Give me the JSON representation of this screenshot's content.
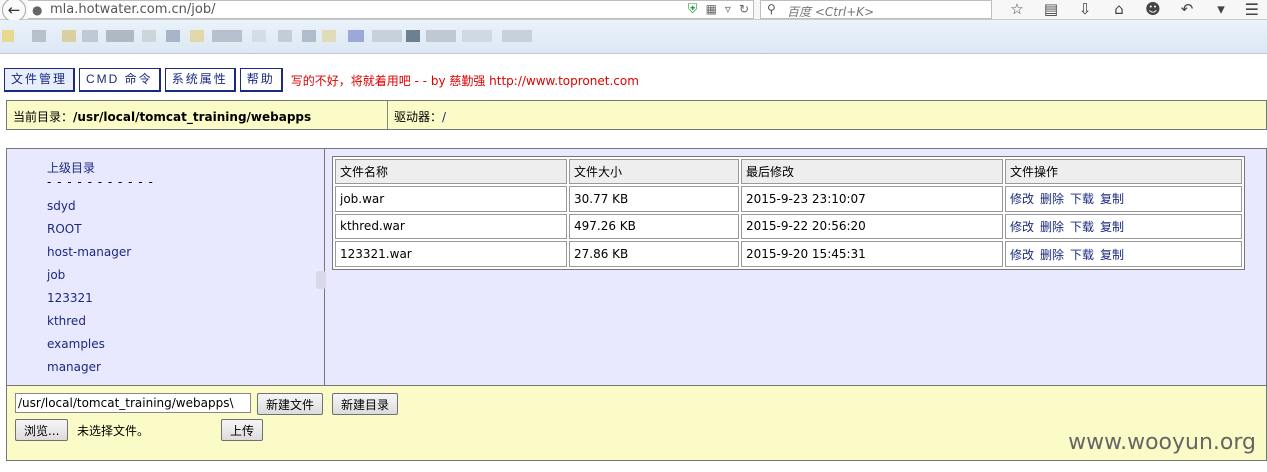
{
  "browser": {
    "url": "mla.hotwater.com.cn/job/",
    "search_placeholder": "百度 <Ctrl+K>"
  },
  "nav": {
    "tabs": [
      "文件管理",
      "CMD 命令",
      "系统属性",
      "帮助"
    ],
    "credit": "写的不好，将就着用吧 - - by 慈勤强 http://www.topronet.com"
  },
  "pathbar": {
    "current_label": "当前目录：",
    "current_path": "/usr/local/tomcat_training/webapps",
    "drive_label": "驱动器：",
    "drive_value": "/"
  },
  "tree": {
    "parent_label": "上级目录",
    "separator": "- - - - - - - - - - -",
    "items": [
      "sdyd",
      "ROOT",
      "host-manager",
      "job",
      "123321",
      "kthred",
      "examples",
      "manager"
    ]
  },
  "files": {
    "headers": [
      "文件名称",
      "文件大小",
      "最后修改",
      "文件操作"
    ],
    "rows": [
      {
        "name": "job.war",
        "size": "30.77 KB",
        "modified": "2015-9-23 23:10:07"
      },
      {
        "name": "kthred.war",
        "size": "497.26 KB",
        "modified": "2015-9-22 20:56:20"
      },
      {
        "name": "123321.war",
        "size": "27.86 KB",
        "modified": "2015-9-20 15:45:31"
      }
    ],
    "operations": [
      "修改",
      "删除",
      "下载",
      "复制"
    ]
  },
  "bottom": {
    "path_value": "/usr/local/tomcat_training/webapps\\",
    "new_file_label": "新建文件",
    "new_dir_label": "新建目录",
    "browse_label": "浏览...",
    "no_file_label": "未选择文件。",
    "upload_label": "上传"
  },
  "watermark": "www.wooyun.org"
}
